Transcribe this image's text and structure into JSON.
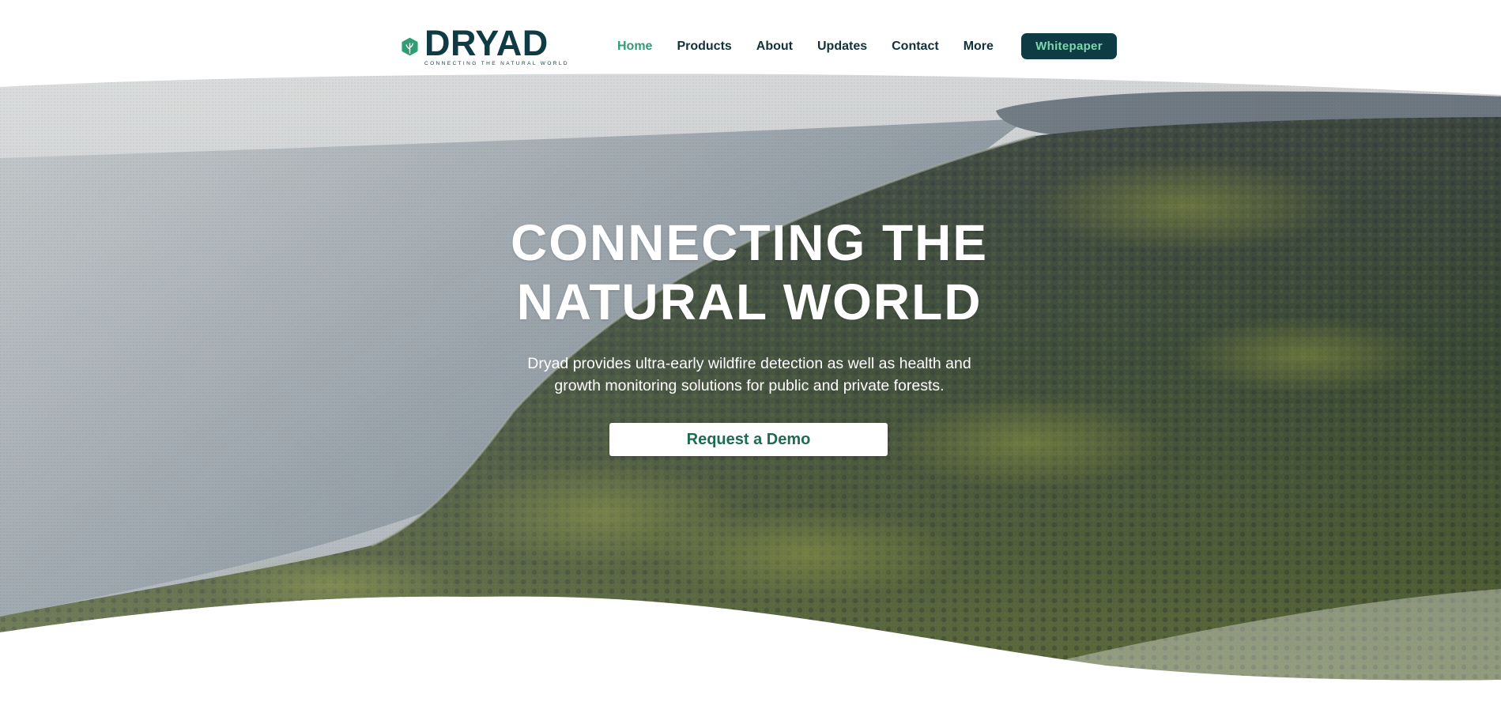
{
  "brand": {
    "name": "DRYAD",
    "tagline": "CONNECTING THE NATURAL WORLD",
    "logo_icon": "tree-hexagon-icon",
    "colors": {
      "primary": "#0f3c44",
      "accent": "#2f9e74",
      "button_text": "#7ed7ad",
      "demo_text": "#1f6b52"
    }
  },
  "nav": {
    "items": [
      {
        "label": "Home",
        "active": true
      },
      {
        "label": "Products",
        "active": false
      },
      {
        "label": "About",
        "active": false
      },
      {
        "label": "Updates",
        "active": false
      },
      {
        "label": "Contact",
        "active": false
      },
      {
        "label": "More",
        "active": false
      }
    ],
    "cta_label": "Whitepaper"
  },
  "hero": {
    "title_line1": "CONNECTING THE",
    "title_line2": "NATURAL WORLD",
    "subtitle_line1": "Dryad provides ultra-early wildfire detection as well as health and",
    "subtitle_line2": "growth monitoring solutions for public and private forests.",
    "button_label": "Request a Demo",
    "background": "aerial-forest-coastline-image"
  }
}
